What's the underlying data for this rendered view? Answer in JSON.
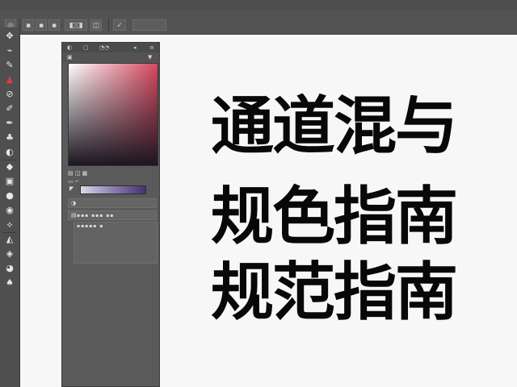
{
  "menubar": {
    "items": [
      "",
      "",
      "",
      "",
      "",
      "",
      ""
    ]
  },
  "options": {
    "preset": "",
    "mode": "",
    "opacity_label": "",
    "mode_dropdown": ""
  },
  "toolbar": {
    "tools": [
      {
        "name": "move-tool-icon",
        "glyph": "✥"
      },
      {
        "name": "lasso-tool-icon",
        "glyph": "⌁"
      },
      {
        "name": "quick-select-icon",
        "glyph": "✎"
      },
      {
        "name": "crop-tool-icon",
        "glyph": "▲"
      },
      {
        "name": "eyedropper-icon",
        "glyph": "⊘"
      },
      {
        "name": "healing-brush-icon",
        "glyph": "✐"
      },
      {
        "name": "brush-tool-icon",
        "glyph": "✒"
      },
      {
        "name": "clone-stamp-icon",
        "glyph": "♣"
      },
      {
        "name": "history-brush-icon",
        "glyph": "◐"
      },
      {
        "name": "eraser-icon",
        "glyph": "◆"
      },
      {
        "name": "gradient-tool-icon",
        "glyph": "▣"
      },
      {
        "name": "blur-tool-icon",
        "glyph": "●"
      },
      {
        "name": "dodge-tool-icon",
        "glyph": "◉"
      },
      {
        "name": "pen-tool-icon",
        "glyph": "⟡"
      },
      {
        "name": "type-tool-icon",
        "glyph": "◭"
      },
      {
        "name": "path-select-icon",
        "glyph": "◈"
      },
      {
        "name": "shape-tool-icon",
        "glyph": "◕"
      },
      {
        "name": "hand-tool-icon",
        "glyph": "♠"
      }
    ],
    "accent": "#e23a3a"
  },
  "color_panel": {
    "tabs": [
      "",
      "",
      ""
    ],
    "gradient_colors": [
      "#d8dbe6",
      "#8a7fb0",
      "#4a2f6e"
    ],
    "field_hue": "#d6485f",
    "swatch_label": "",
    "row1_label": "",
    "row2_label": ""
  },
  "canvas": {
    "headline_lines": [
      "通道混与",
      "规色指南",
      "规范指南"
    ]
  }
}
